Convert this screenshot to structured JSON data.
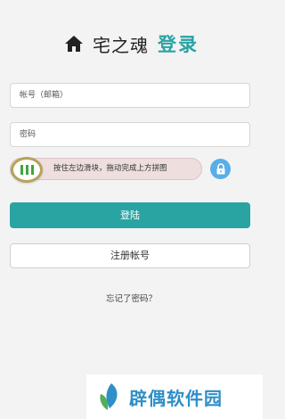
{
  "header": {
    "icon": "home-icon",
    "brand": "宅之魂",
    "title": "登录"
  },
  "form": {
    "account_placeholder": "帐号（邮箱）",
    "password_placeholder": "密码"
  },
  "captcha": {
    "hint": "按住左边滑块，拖动完成上方拼图",
    "handle_icon": "grip-icon",
    "lock_icon": "lock-icon"
  },
  "buttons": {
    "login": "登陆",
    "register": "注册帐号"
  },
  "links": {
    "forgot": "忘记了密码？"
  },
  "watermark": {
    "text": "辟偶软件园"
  },
  "colors": {
    "accent": "#2aa3a3",
    "lock_badge": "#59aee6",
    "background": "#f3f3f4",
    "watermark": "#2f8fc8"
  }
}
